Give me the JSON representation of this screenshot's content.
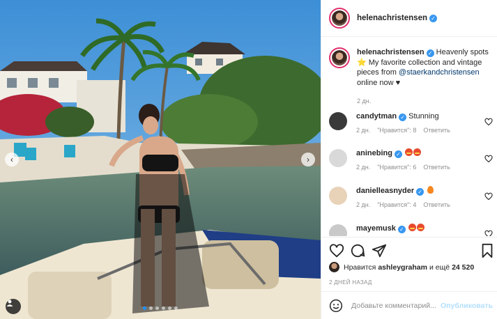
{
  "post": {
    "author": "helenachristensen",
    "photo": {
      "carousel_dots": 6,
      "active_dot": 0,
      "icons": {
        "prev": "chevron-left-icon",
        "next": "chevron-right-icon",
        "tag": "user-tag-icon"
      }
    },
    "caption": {
      "username": "helenachristensen",
      "text": " Heavenly spots ⭐ My favorite collection and vintage pieces from ",
      "mention": "@staerkandchristensen",
      "text_end": " online now ♥",
      "time": "2 дн."
    },
    "comments": [
      {
        "username": "candytman",
        "verified": true,
        "text": "Stunning",
        "emojis": [],
        "time": "2 дн.",
        "likes_label": "\"Нравится\": 8",
        "reply": "Ответить",
        "avatar_color": "#3a3a3a"
      },
      {
        "username": "aninebing",
        "verified": true,
        "text": "",
        "emojis": [
          "heart-eyes",
          "heart-eyes"
        ],
        "time": "2 дн.",
        "likes_label": "\"Нравится\": 6",
        "reply": "Ответить",
        "avatar_color": "#d9d9d9"
      },
      {
        "username": "danielleasnyder",
        "verified": true,
        "text": "",
        "emojis": [
          "fire"
        ],
        "time": "2 дн.",
        "likes_label": "\"Нравится\": 4",
        "reply": "Ответить",
        "avatar_color": "#e8d2b8"
      },
      {
        "username": "mayemusk",
        "verified": true,
        "text": "",
        "emojis": [
          "heart-eyes",
          "heart-eyes"
        ],
        "time": "",
        "likes_label": "",
        "reply": "",
        "avatar_color": "#c9c9c9"
      }
    ],
    "likes": {
      "prefix": "Нравится",
      "user": "ashleygraham",
      "middle": "и ещё",
      "count": "24 520"
    },
    "posted_ago": "2 ДНЕЙ НАЗАД",
    "add_comment": {
      "placeholder": "Добавьте комментарий...",
      "publish_label": "Опубликовать"
    },
    "colors": {
      "accent": "#3897f0",
      "story_ring": "#e1306c",
      "muted": "#8e8e8e",
      "publish_disabled": "#b2dffc"
    }
  }
}
